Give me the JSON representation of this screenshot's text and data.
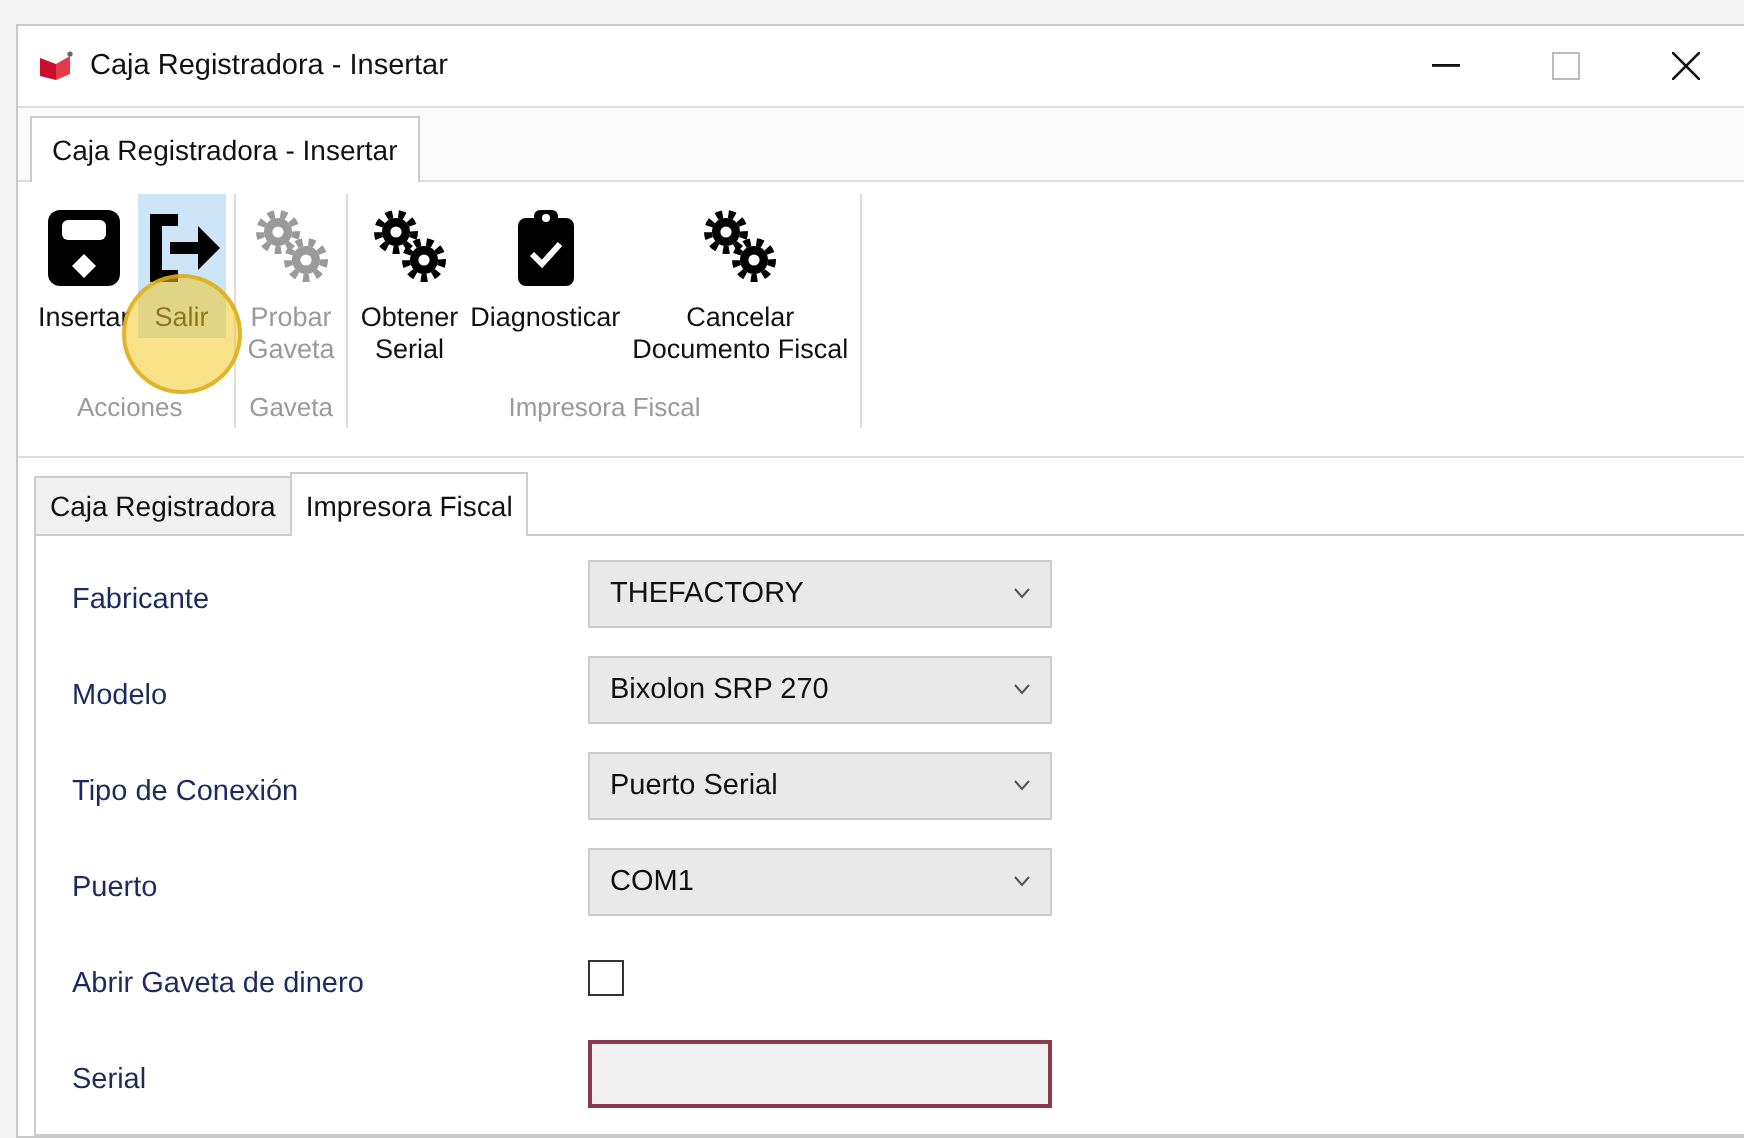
{
  "window": {
    "title": "Caja Registradora - Insertar"
  },
  "document_tabs": [
    {
      "label": "Caja Registradora - Insertar",
      "selected": true
    }
  ],
  "ribbon": {
    "groups": [
      {
        "label": "Acciones",
        "buttons": [
          {
            "label": "Insertar",
            "kind": "save",
            "disabled": false,
            "hovered": false
          },
          {
            "label": "Salir",
            "kind": "exit",
            "disabled": false,
            "hovered": true
          }
        ]
      },
      {
        "label": "Gaveta",
        "buttons": [
          {
            "label": "Probar\nGaveta",
            "kind": "gears",
            "disabled": true,
            "hovered": false
          }
        ]
      },
      {
        "label": "Impresora Fiscal",
        "buttons": [
          {
            "label": "Obtener\nSerial",
            "kind": "gears",
            "disabled": false,
            "hovered": false
          },
          {
            "label": "Diagnosticar",
            "kind": "clipboard",
            "disabled": false,
            "hovered": false
          },
          {
            "label": "Cancelar\nDocumento Fiscal",
            "kind": "gears",
            "disabled": false,
            "hovered": false
          }
        ]
      }
    ]
  },
  "form_tabs": [
    {
      "label": "Caja Registradora",
      "selected": false
    },
    {
      "label": "Impresora Fiscal",
      "selected": true
    }
  ],
  "fields": [
    {
      "kind": "combo",
      "label": "Fabricante",
      "value": "THEFACTORY"
    },
    {
      "kind": "combo",
      "label": "Modelo",
      "value": "Bixolon SRP 270"
    },
    {
      "kind": "combo",
      "label": "Tipo de Conexión",
      "value": "Puerto Serial"
    },
    {
      "kind": "combo",
      "label": "Puerto",
      "value": "COM1"
    },
    {
      "kind": "checkbox",
      "label": "Abrir Gaveta de dinero",
      "checked": false
    },
    {
      "kind": "text",
      "label": "Serial",
      "invalid": true
    }
  ]
}
